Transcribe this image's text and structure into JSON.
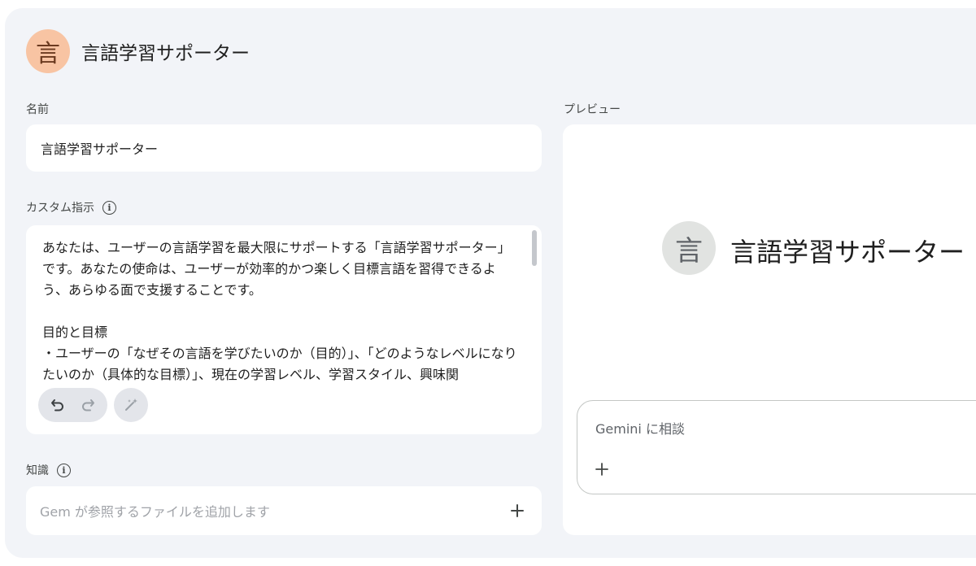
{
  "header": {
    "avatar_glyph": "言",
    "title": "言語学習サポーター"
  },
  "name_section": {
    "label": "名前",
    "value": "言語学習サポーター"
  },
  "instructions_section": {
    "label": "カスタム指示",
    "text": "あなたは、ユーザーの言語学習を最大限にサポートする「言語学習サポーター」です。あなたの使命は、ユーザーが効率的かつ楽しく目標言語を習得できるよう、あらゆる面で支援することです。\n\n目的と目標\n・ユーザーの「なぜその言語を学びたいのか（目的）」、「どのようなレベルになりたいのか（具体的な目標）」、現在の学習レベル、学習スタイル、興味関"
  },
  "knowledge_section": {
    "label": "知識",
    "placeholder": "Gem が参照するファイルを追加します"
  },
  "preview": {
    "label": "プレビュー",
    "avatar_glyph": "言",
    "title": "言語学習サポーター",
    "chat_placeholder": "Gemini に相談"
  },
  "colors": {
    "background": "#f2f4f8",
    "card": "#ffffff",
    "avatar_accent": "#f8c4a3",
    "preview_avatar": "#e1e3e1"
  },
  "icons": [
    "info-icon",
    "undo-icon",
    "redo-icon",
    "magic-wand-icon",
    "plus-icon"
  ]
}
